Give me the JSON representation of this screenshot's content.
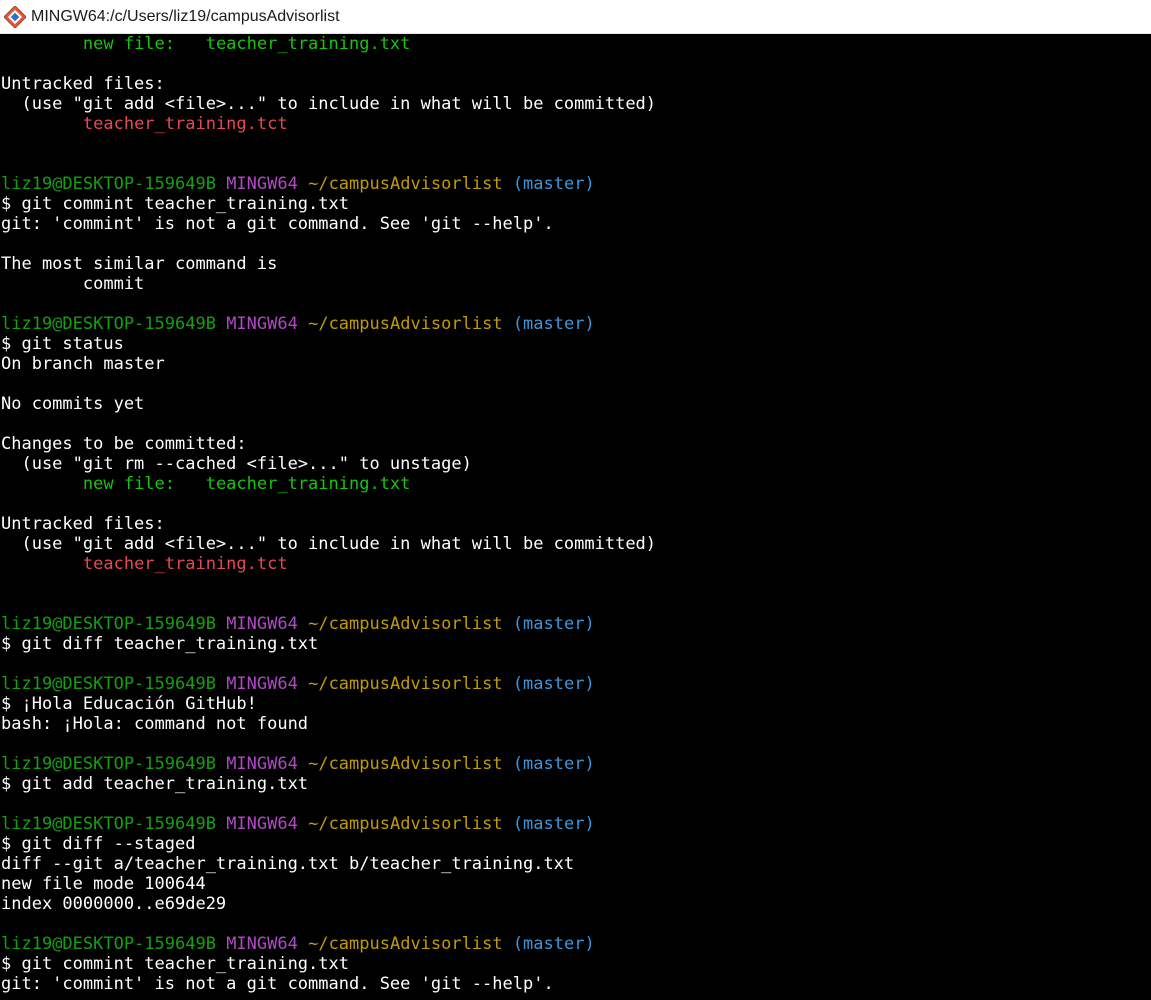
{
  "window": {
    "title": "MINGW64:/c/Users/liz19/campusAdvisorlist",
    "icon": "git-bash-icon"
  },
  "colors": {
    "background": "#000000",
    "default": "#ffffff",
    "green": "#16c60c",
    "user": "#13a10e",
    "purple": "#b148c6",
    "yellow": "#c19c00",
    "cyan": "#3a96dd",
    "red": "#e74856"
  },
  "terminal_lines": [
    [
      {
        "t": "        "
      },
      {
        "t": "new file:   teacher_training.txt",
        "c": "green"
      }
    ],
    [],
    [
      {
        "t": "Untracked files:"
      }
    ],
    [
      {
        "t": "  (use \"git add <file>...\" to include in what will be committed)"
      }
    ],
    [
      {
        "t": "        "
      },
      {
        "t": "teacher_training.tct",
        "c": "red"
      }
    ],
    [],
    [],
    [
      {
        "t": "liz19@DESKTOP-159649B",
        "c": "user"
      },
      {
        "t": " "
      },
      {
        "t": "MINGW64",
        "c": "purple"
      },
      {
        "t": " "
      },
      {
        "t": "~/campusAdvisorlist",
        "c": "yellow"
      },
      {
        "t": " "
      },
      {
        "t": "(master)",
        "c": "cyan"
      }
    ],
    [
      {
        "t": "$ git commint teacher_training.txt"
      }
    ],
    [
      {
        "t": "git: 'commint' is not a git command. See 'git --help'."
      }
    ],
    [],
    [
      {
        "t": "The most similar command is"
      }
    ],
    [
      {
        "t": "        commit"
      }
    ],
    [],
    [
      {
        "t": "liz19@DESKTOP-159649B",
        "c": "user"
      },
      {
        "t": " "
      },
      {
        "t": "MINGW64",
        "c": "purple"
      },
      {
        "t": " "
      },
      {
        "t": "~/campusAdvisorlist",
        "c": "yellow"
      },
      {
        "t": " "
      },
      {
        "t": "(master)",
        "c": "cyan"
      }
    ],
    [
      {
        "t": "$ git status"
      }
    ],
    [
      {
        "t": "On branch master"
      }
    ],
    [],
    [
      {
        "t": "No commits yet"
      }
    ],
    [],
    [
      {
        "t": "Changes to be committed:"
      }
    ],
    [
      {
        "t": "  (use \"git rm --cached <file>...\" to unstage)"
      }
    ],
    [
      {
        "t": "        "
      },
      {
        "t": "new file:   teacher_training.txt",
        "c": "green"
      }
    ],
    [],
    [
      {
        "t": "Untracked files:"
      }
    ],
    [
      {
        "t": "  (use \"git add <file>...\" to include in what will be committed)"
      }
    ],
    [
      {
        "t": "        "
      },
      {
        "t": "teacher_training.tct",
        "c": "red"
      }
    ],
    [],
    [],
    [
      {
        "t": "liz19@DESKTOP-159649B",
        "c": "user"
      },
      {
        "t": " "
      },
      {
        "t": "MINGW64",
        "c": "purple"
      },
      {
        "t": " "
      },
      {
        "t": "~/campusAdvisorlist",
        "c": "yellow"
      },
      {
        "t": " "
      },
      {
        "t": "(master)",
        "c": "cyan"
      }
    ],
    [
      {
        "t": "$ git diff teacher_training.txt"
      }
    ],
    [],
    [
      {
        "t": "liz19@DESKTOP-159649B",
        "c": "user"
      },
      {
        "t": " "
      },
      {
        "t": "MINGW64",
        "c": "purple"
      },
      {
        "t": " "
      },
      {
        "t": "~/campusAdvisorlist",
        "c": "yellow"
      },
      {
        "t": " "
      },
      {
        "t": "(master)",
        "c": "cyan"
      }
    ],
    [
      {
        "t": "$ ¡Hola Educación GitHub!"
      }
    ],
    [
      {
        "t": "bash: ¡Hola: command not found"
      }
    ],
    [],
    [
      {
        "t": "liz19@DESKTOP-159649B",
        "c": "user"
      },
      {
        "t": " "
      },
      {
        "t": "MINGW64",
        "c": "purple"
      },
      {
        "t": " "
      },
      {
        "t": "~/campusAdvisorlist",
        "c": "yellow"
      },
      {
        "t": " "
      },
      {
        "t": "(master)",
        "c": "cyan"
      }
    ],
    [
      {
        "t": "$ git add teacher_training.txt"
      }
    ],
    [],
    [
      {
        "t": "liz19@DESKTOP-159649B",
        "c": "user"
      },
      {
        "t": " "
      },
      {
        "t": "MINGW64",
        "c": "purple"
      },
      {
        "t": " "
      },
      {
        "t": "~/campusAdvisorlist",
        "c": "yellow"
      },
      {
        "t": " "
      },
      {
        "t": "(master)",
        "c": "cyan"
      }
    ],
    [
      {
        "t": "$ git diff --staged"
      }
    ],
    [
      {
        "t": "diff --git a/teacher_training.txt b/teacher_training.txt"
      }
    ],
    [
      {
        "t": "new file mode 100644"
      }
    ],
    [
      {
        "t": "index 0000000..e69de29"
      }
    ],
    [],
    [
      {
        "t": "liz19@DESKTOP-159649B",
        "c": "user"
      },
      {
        "t": " "
      },
      {
        "t": "MINGW64",
        "c": "purple"
      },
      {
        "t": " "
      },
      {
        "t": "~/campusAdvisorlist",
        "c": "yellow"
      },
      {
        "t": " "
      },
      {
        "t": "(master)",
        "c": "cyan"
      }
    ],
    [
      {
        "t": "$ git commint teacher_training.txt"
      }
    ],
    [
      {
        "t": "git: 'commint' is not a git command. See 'git --help'."
      }
    ]
  ]
}
